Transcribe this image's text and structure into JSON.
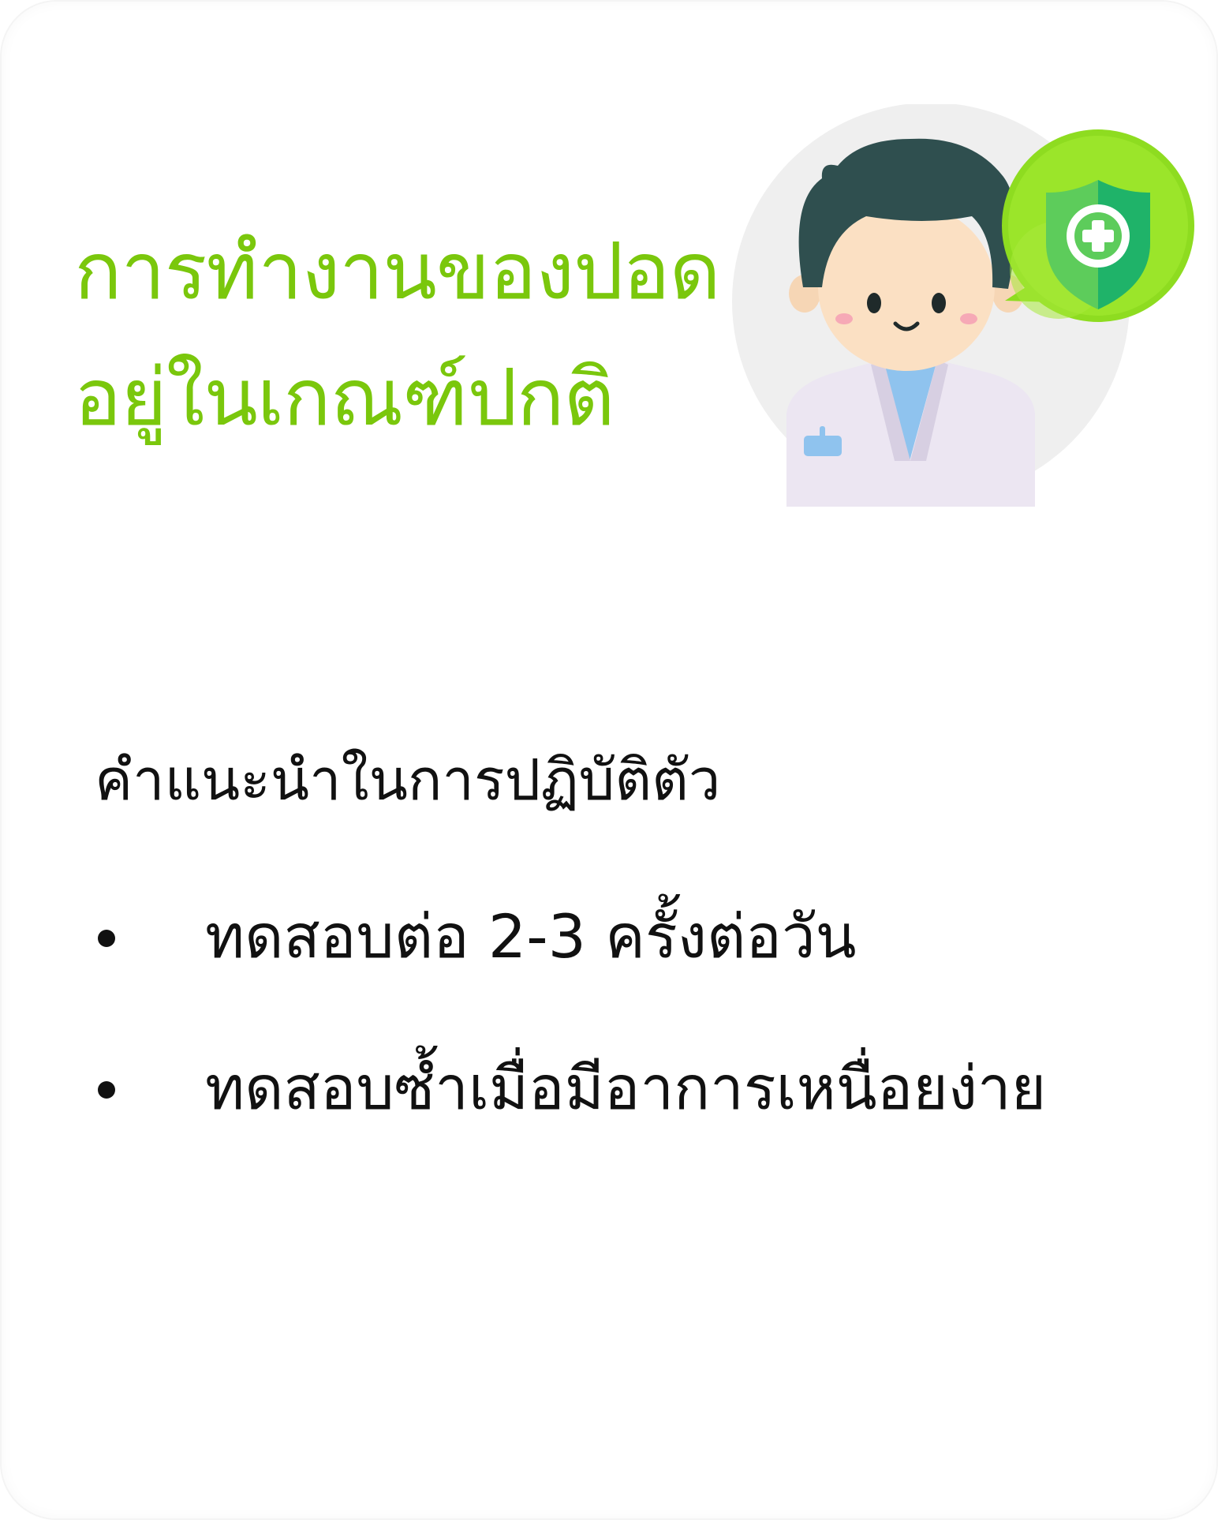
{
  "title": {
    "line1": "การทำงานของปอด",
    "line2": "อยู่ในเกณฑ์ปกติ"
  },
  "illustration": {
    "icons": [
      "doctor-avatar",
      "shield-plus-icon"
    ],
    "accent_color": "#7ac70c"
  },
  "advice": {
    "heading": "คำแนะนำในการปฏิบัติตัว",
    "items": [
      "ทดสอบต่อ 2-3 ครั้งต่อวัน",
      "ทดสอบซ้ำเมื่อมีอาการเหนื่อยง่าย"
    ]
  }
}
